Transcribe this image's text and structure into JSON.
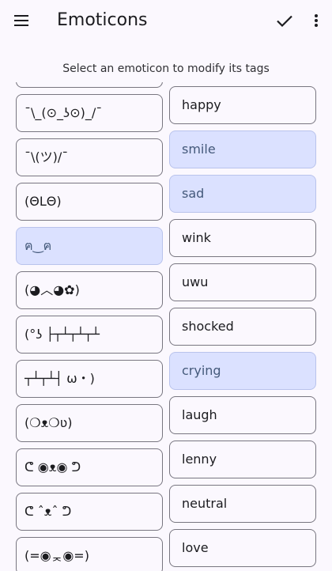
{
  "header": {
    "title": "Emoticons",
    "menu_icon": "menu-icon",
    "confirm_icon": "check-icon",
    "overflow_icon": "more-vert-icon"
  },
  "instructions": "Select an emoticon to modify its tags",
  "emoticons": [
    {
      "text": "",
      "selected": false
    },
    {
      "text": "¯\\_(⊙_ʖ⊙)_/¯",
      "selected": false
    },
    {
      "text": "¯\\(ツ)/¯",
      "selected": false
    },
    {
      "text": "(ΘLΘ)",
      "selected": false
    },
    {
      "text": "ฅ‿ฅ",
      "selected": true
    },
    {
      "text": "(◕︿◕✿)",
      "selected": false
    },
    {
      "text": "(°ʖ ├┬┴┬┴┬┴",
      "selected": false
    },
    {
      "text": "┬┴┬┴┤ ω・)",
      "selected": false
    },
    {
      "text": "(❍ᴥ❍ʋ)",
      "selected": false
    },
    {
      "text": "ᕦ ◉ᴥ◉ ᕤ",
      "selected": false
    },
    {
      "text": "ᕦ ˆᴥˆ ᕤ",
      "selected": false
    },
    {
      "text": "(=◉ᆽ◉=)",
      "selected": false
    }
  ],
  "tags": [
    {
      "text": "happy",
      "selected": false
    },
    {
      "text": "smile",
      "selected": true
    },
    {
      "text": "sad",
      "selected": true
    },
    {
      "text": "wink",
      "selected": false
    },
    {
      "text": "uwu",
      "selected": false
    },
    {
      "text": "shocked",
      "selected": false
    },
    {
      "text": "crying",
      "selected": true
    },
    {
      "text": "laugh",
      "selected": false
    },
    {
      "text": "lenny",
      "selected": false
    },
    {
      "text": "neutral",
      "selected": false
    },
    {
      "text": "love",
      "selected": false
    }
  ],
  "colors": {
    "background": "#fbf8fe",
    "selected_fill": "#dbe1ff",
    "selected_text": "#44597a",
    "outline": "#787680"
  }
}
